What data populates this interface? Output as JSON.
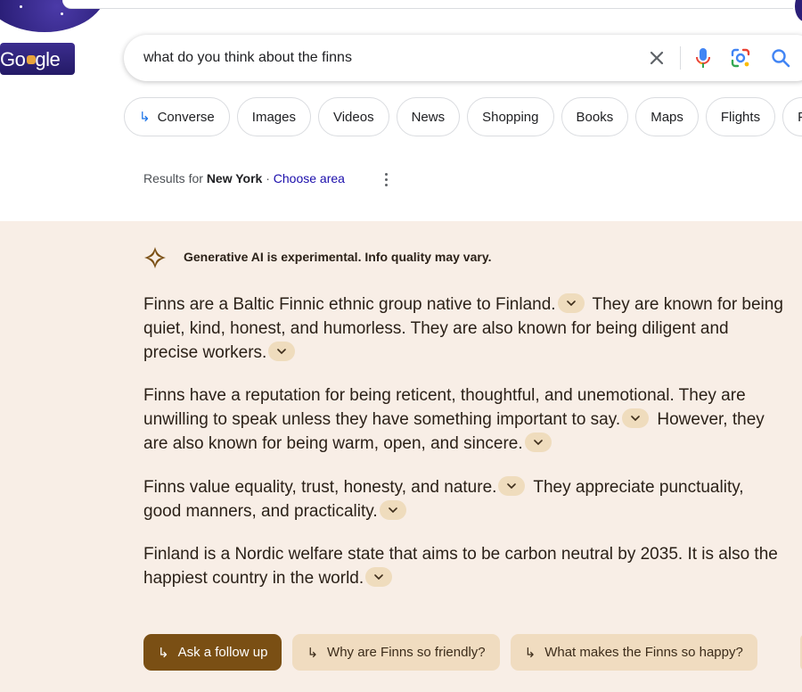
{
  "logo": {
    "text_left": "Go",
    "text_right": "gle"
  },
  "search": {
    "query": "what do you think about the finns"
  },
  "icons": {
    "clear": "close-icon",
    "mic": "microphone-icon",
    "lens": "lens-icon",
    "search": "search-icon",
    "more": "more-vert-icon",
    "spark": "ai-spark-icon",
    "cite": "chevron-down-icon",
    "arrow": "subdirectory-arrow-icon"
  },
  "chips": [
    {
      "label": "Converse",
      "arrow": "↳"
    },
    {
      "label": "Images"
    },
    {
      "label": "Videos"
    },
    {
      "label": "News"
    },
    {
      "label": "Shopping"
    },
    {
      "label": "Books"
    },
    {
      "label": "Maps"
    },
    {
      "label": "Flights"
    },
    {
      "label": "F"
    }
  ],
  "location": {
    "prefix": "Results for ",
    "place": "New York",
    "separator": " · ",
    "choose": "Choose area"
  },
  "ai": {
    "notice": "Generative AI is experimental. Info quality may vary.",
    "p1a": "Finns are a Baltic Finnic ethnic group native to Finland.",
    "p1b": " They are known for being quiet, kind, honest, and humorless. They are also known for being diligent and precise workers.",
    "p2a": "Finns have a reputation for being reticent, thoughtful, and unemotional. They are unwilling to speak unless they have something important to say.",
    "p2b": " However, they are also known for being warm, open, and sincere.",
    "p3a": "Finns value equality, trust, honesty, and nature.",
    "p3b": " They appreciate punctuality, good manners, and practicality.",
    "p4a": "Finland is a Nordic welfare state that aims to be carbon neutral by 2035. It is also the happiest country in the world."
  },
  "followups": [
    {
      "label": "Ask a follow up",
      "arrow": "↳"
    },
    {
      "label": "Why are Finns so friendly?",
      "arrow": "↳"
    },
    {
      "label": "What makes the Finns so happy?",
      "arrow": "↳"
    }
  ],
  "colors": {
    "panel_bg": "#f8eee6",
    "primary_followup": "#7a4f14",
    "secondary_followup": "#f0dcc0",
    "cite_pill": "#efdcbd",
    "link": "#1a0dab",
    "accent_blue": "#1a73e8"
  }
}
